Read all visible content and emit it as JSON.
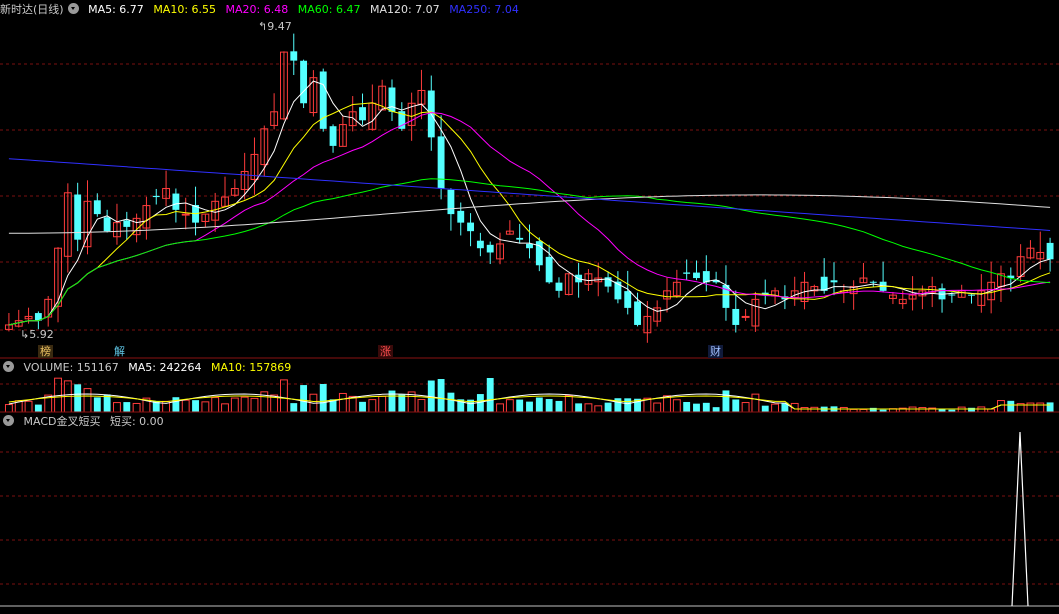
{
  "main_legend": {
    "title": "新时达(日线)",
    "ma5": "MA5: 6.77",
    "ma10": "MA10: 6.55",
    "ma20": "MA20: 6.48",
    "ma60": "MA60: 6.47",
    "ma120": "MA120: 7.07",
    "ma250": "MA250: 7.04"
  },
  "vol_legend": {
    "volume": "VOLUME: 151167",
    "ma5": "MA5: 242264",
    "ma10": "MA10: 157869"
  },
  "macd_legend": {
    "title": "MACD金叉短买",
    "value": "短买: 0.00"
  },
  "annotations": {
    "high": "9.47",
    "low": "5.92"
  },
  "events": [
    {
      "label": "榜",
      "color": "#e8c060"
    },
    {
      "label": "解",
      "color": "#60c8e8"
    },
    {
      "label": "涨",
      "color": "#ff5050"
    },
    {
      "label": "财",
      "color": "#a0c0ff"
    }
  ],
  "colors": {
    "up": "#ff3c3c",
    "down": "#54ffff",
    "ma5": "#ffffff",
    "ma10": "#ffff00",
    "ma20": "#ff00ff",
    "ma60": "#00ff00",
    "ma120": "#e0e0e0",
    "ma250": "#3030ff",
    "grid": "#7a1010"
  },
  "chart_data": {
    "type": "candlestick",
    "price_range": [
      5.8,
      9.6
    ],
    "closes": [
      6.0,
      6.05,
      6.1,
      6.05,
      6.3,
      6.9,
      7.55,
      7.0,
      7.45,
      7.3,
      7.1,
      7.2,
      7.15,
      7.25,
      7.4,
      7.5,
      7.6,
      7.35,
      7.3,
      7.2,
      7.3,
      7.45,
      7.5,
      7.6,
      7.8,
      8.0,
      8.3,
      8.5,
      9.2,
      9.1,
      8.6,
      8.9,
      8.3,
      8.1,
      8.35,
      8.5,
      8.4,
      8.6,
      8.8,
      8.5,
      8.3,
      8.6,
      8.75,
      8.2,
      7.6,
      7.3,
      7.2,
      7.1,
      6.9,
      6.85,
      6.95,
      7.1,
      7.0,
      6.9,
      6.7,
      6.5,
      6.4,
      6.6,
      6.5,
      6.6,
      6.55,
      6.45,
      6.3,
      6.2,
      6.0,
      6.1,
      6.2,
      6.4,
      6.5,
      6.6,
      6.55,
      6.5,
      6.5,
      6.2,
      6.0,
      6.1,
      6.3,
      6.35,
      6.4,
      6.3,
      6.4,
      6.5,
      6.45,
      6.4,
      6.5,
      6.4,
      6.45,
      6.55,
      6.5,
      6.4,
      6.35,
      6.3,
      6.35,
      6.4,
      6.45,
      6.3,
      6.35,
      6.4,
      6.35,
      6.4,
      6.5,
      6.6,
      6.55,
      6.8,
      6.9,
      6.85,
      6.77
    ],
    "volume_ma5": 242264,
    "volume_ma10": 157869,
    "macd_signal": "single buy spike near last bars"
  }
}
